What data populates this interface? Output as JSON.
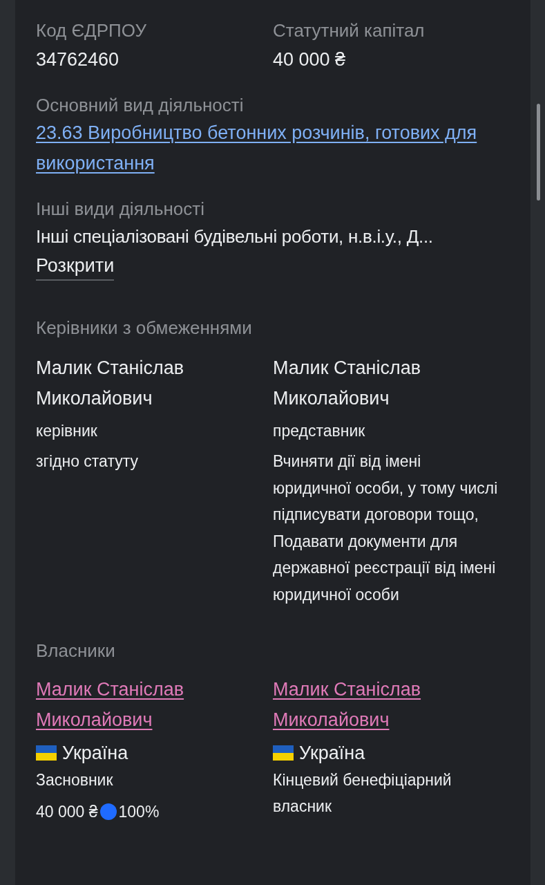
{
  "top_fields": [
    {
      "label": "Код ЄДРПОУ",
      "value": "34762460"
    },
    {
      "label": "Статутний капітал",
      "value": "40 000 ₴"
    }
  ],
  "main_activity": {
    "label": "Основний вид діяльності",
    "link": "23.63 Виробництво бетонних розчинів, готових для використання"
  },
  "other_activities": {
    "label": "Інші види діяльності",
    "text": "Інші спеціалізовані будівельні роботи, н.в.і.у., Д...",
    "expand": "Розкрити"
  },
  "managers": {
    "title": "Керівники з обмеженнями",
    "items": [
      {
        "name": "Малик Станіслав Миколайович",
        "role": "керівник",
        "note": "згідно статуту"
      },
      {
        "name": "Малик Станіслав Миколайович",
        "role": "представник",
        "note": "Вчиняти дії від імені юридичної особи, у тому числі підписувати договори тощо, Подавати документи для державної реєстрації від імені юридичної особи"
      }
    ]
  },
  "owners": {
    "title": "Власники",
    "items": [
      {
        "name": "Малик Станіслав Миколайович",
        "country": "Україна",
        "role": "Засновник",
        "share": {
          "amount": "40 000 ₴",
          "percent": "100%",
          "color": "#1f6bff"
        }
      },
      {
        "name": "Малик Станіслав Миколайович",
        "country": "Україна",
        "role": "Кінцевий бенефіціарний власник"
      }
    ]
  }
}
